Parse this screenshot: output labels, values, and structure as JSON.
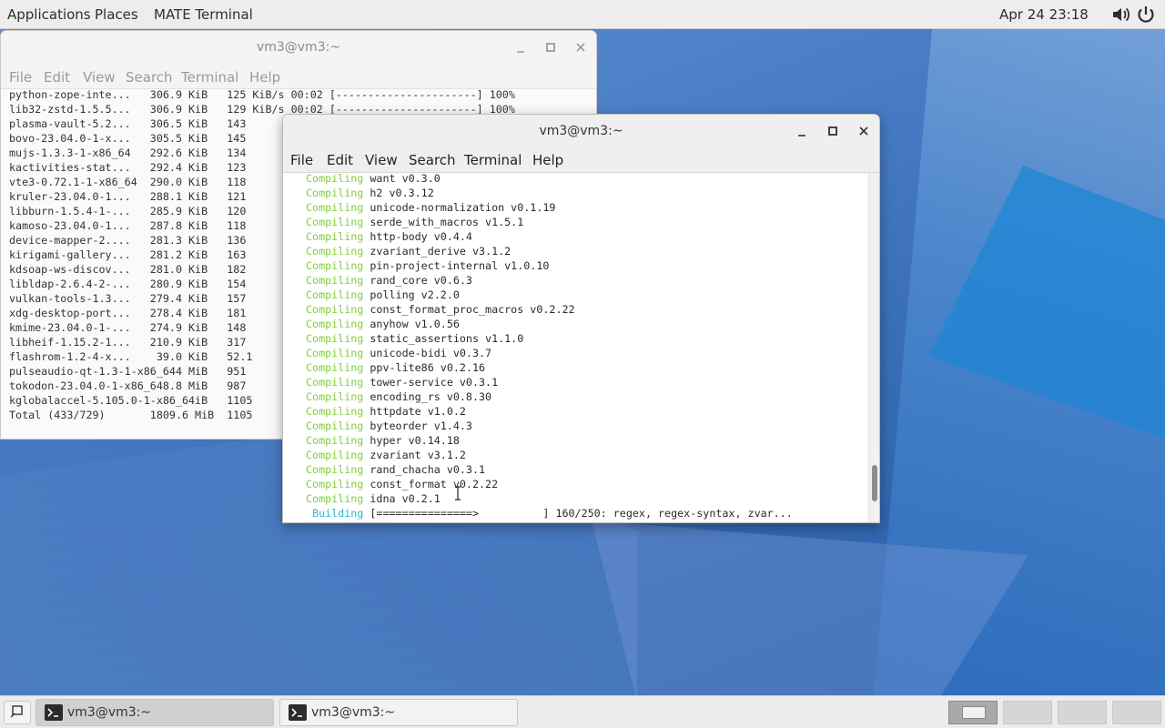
{
  "top_panel": {
    "applications": "Applications",
    "places": "Places",
    "terminal_launcher": "MATE Terminal",
    "clock": "Apr 24  23:18"
  },
  "back_window": {
    "title": "vm3@vm3:~",
    "menu": [
      "File",
      "Edit",
      "View",
      "Search",
      "Terminal",
      "Help"
    ],
    "lines": [
      "python-zope-inte...   306.9 KiB   125 KiB/s 00:02 [----------------------] 100%",
      "lib32-zstd-1.5.5...   306.9 KiB   129 KiB/s 00:02 [----------------------] 100%",
      "plasma-vault-5.2...   306.5 KiB   143",
      "bovo-23.04.0-1-x...   305.5 KiB   145",
      "mujs-1.3.3-1-x86_64   292.6 KiB   134",
      "kactivities-stat...   292.4 KiB   123",
      "vte3-0.72.1-1-x86_64  290.0 KiB   118",
      "kruler-23.04.0-1...   288.1 KiB   121",
      "libburn-1.5.4-1-...   285.9 KiB   120",
      "kamoso-23.04.0-1...   287.8 KiB   118",
      "device-mapper-2....   281.3 KiB   136",
      "kirigami-gallery...   281.2 KiB   163",
      "kdsoap-ws-discov...   281.0 KiB   182",
      "libldap-2.6.4-2-...   280.9 KiB   154",
      "vulkan-tools-1.3...   279.4 KiB   157",
      "xdg-desktop-port...   278.4 KiB   181",
      "kmime-23.04.0-1-...   274.9 KiB   148",
      "libheif-1.15.2-1...   210.9 KiB   317",
      "flashrom-1.2-4-x...    39.0 KiB   52.1",
      "pulseaudio-qt-1.3-1-x86_644 MiB   951",
      "tokodon-23.04.0-1-x86_648.8 MiB   987",
      "kglobalaccel-5.105.0-1-x86_64iB   1105",
      "Total (433/729)       1809.6 MiB  1105"
    ]
  },
  "front_window": {
    "title": "vm3@vm3:~",
    "menu": [
      "File",
      "Edit",
      "View",
      "Search",
      "Terminal",
      "Help"
    ],
    "compile_keyword": "Compiling",
    "compile_lines": [
      "want v0.3.0",
      "h2 v0.3.12",
      "unicode-normalization v0.1.19",
      "serde_with_macros v1.5.1",
      "http-body v0.4.4",
      "zvariant_derive v3.1.2",
      "pin-project-internal v1.0.10",
      "rand_core v0.6.3",
      "polling v2.2.0",
      "const_format_proc_macros v0.2.22",
      "anyhow v1.0.56",
      "static_assertions v1.1.0",
      "unicode-bidi v0.3.7",
      "ppv-lite86 v0.2.16",
      "tower-service v0.3.1",
      "encoding_rs v0.8.30",
      "httpdate v1.0.2",
      "byteorder v1.4.3",
      "hyper v0.14.18",
      "zvariant v3.1.2",
      "rand_chacha v0.3.1",
      "const_format v0.2.22",
      "idna v0.2.1"
    ],
    "build_keyword": "Building",
    "build_line": "[===============>          ] 160/250: regex, regex-syntax, zvar...",
    "scroll_position": 0.93
  },
  "taskbar": {
    "tasks": [
      {
        "label": "vm3@vm3:~",
        "active": true
      },
      {
        "label": "vm3@vm3:~",
        "active": false
      }
    ],
    "workspaces": 4,
    "active_workspace": 1
  },
  "colors": {
    "compile": "#7fcf3a",
    "build": "#29b6c8",
    "desktop": "#3b70b8"
  }
}
